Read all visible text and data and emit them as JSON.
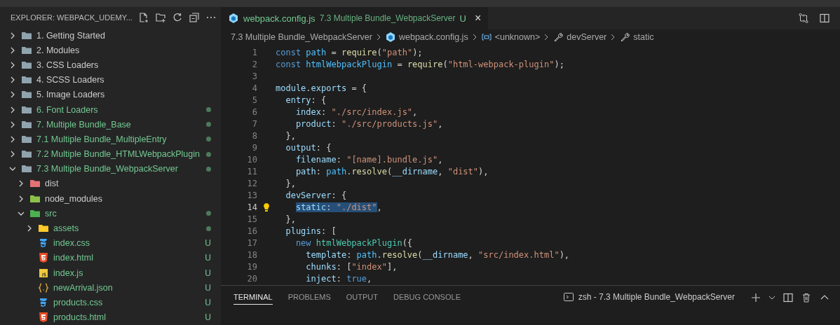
{
  "sidebar": {
    "title": "EXPLORER: WEBPACK_UDEMY...",
    "tree": [
      {
        "name": "1. Getting Started",
        "kind": "folder",
        "expanded": false,
        "modified": false
      },
      {
        "name": "2. Modules",
        "kind": "folder",
        "expanded": false,
        "modified": false
      },
      {
        "name": "3. CSS Loaders",
        "kind": "folder",
        "expanded": false,
        "modified": false
      },
      {
        "name": "4. SCSS Loaders",
        "kind": "folder",
        "expanded": false,
        "modified": false
      },
      {
        "name": "5. Image Loaders",
        "kind": "folder",
        "expanded": false,
        "modified": false
      },
      {
        "name": "6. Font Loaders",
        "kind": "folder",
        "expanded": false,
        "modified": true
      },
      {
        "name": "7. Multiple Bundle_Base",
        "kind": "folder",
        "expanded": false,
        "modified": true
      },
      {
        "name": "7.1 Multiple Bundle_MultipleEntry",
        "kind": "folder",
        "expanded": false,
        "modified": true
      },
      {
        "name": "7.2 Multiple Bundle_HTMLWebpackPlugin",
        "kind": "folder",
        "expanded": false,
        "modified": true
      },
      {
        "name": "7.3 Multiple Bundle_WebpackServer",
        "kind": "folder",
        "expanded": true,
        "modified": true,
        "children": [
          {
            "name": "dist",
            "kind": "folder-dist",
            "expanded": false,
            "modified": false
          },
          {
            "name": "node_modules",
            "kind": "folder-node",
            "expanded": false,
            "modified": false
          },
          {
            "name": "src",
            "kind": "folder-src",
            "expanded": true,
            "modified": true,
            "children": [
              {
                "name": "assets",
                "kind": "folder-assets",
                "expanded": false,
                "modified": true
              },
              {
                "name": "index.css",
                "kind": "css",
                "badge": "U"
              },
              {
                "name": "index.html",
                "kind": "html",
                "badge": "U"
              },
              {
                "name": "index.js",
                "kind": "js",
                "badge": "U"
              },
              {
                "name": "newArrival.json",
                "kind": "json",
                "badge": "U"
              },
              {
                "name": "products.css",
                "kind": "css",
                "badge": "U"
              },
              {
                "name": "products.html",
                "kind": "html",
                "badge": "U"
              }
            ]
          }
        ]
      }
    ]
  },
  "editor": {
    "tabs": [
      {
        "name": "webpack.config.js",
        "description": "7.3 Multiple Bundle_WebpackServer",
        "badge": "U",
        "close": "×",
        "selected": true
      }
    ],
    "breadcrumbs": [
      {
        "text": "7.3 Multiple Bundle_WebpackServer",
        "kind": "folder"
      },
      {
        "text": "webpack.config.js",
        "kind": "webpack"
      },
      {
        "text": "<unknown>",
        "kind": "variable"
      },
      {
        "text": "devServer",
        "kind": "property"
      },
      {
        "text": "static",
        "kind": "property"
      }
    ],
    "lines": [
      {
        "num": "1",
        "current": false,
        "lightbulb": false,
        "tokens": [
          {
            "text": "const ",
            "kind": "kw"
          },
          {
            "text": "path",
            "kind": "const"
          },
          {
            "text": " = ",
            "kind": "p"
          },
          {
            "text": "require",
            "kind": "fn"
          },
          {
            "text": "(",
            "kind": "p"
          },
          {
            "text": "\"path\"",
            "kind": "str"
          },
          {
            "text": ");",
            "kind": "p"
          }
        ]
      },
      {
        "num": "2",
        "current": false,
        "lightbulb": false,
        "tokens": [
          {
            "text": "const ",
            "kind": "kw"
          },
          {
            "text": "htmlWebpackPlugin",
            "kind": "const"
          },
          {
            "text": " = ",
            "kind": "p"
          },
          {
            "text": "require",
            "kind": "fn"
          },
          {
            "text": "(",
            "kind": "p"
          },
          {
            "text": "\"html-webpack-plugin\"",
            "kind": "str"
          },
          {
            "text": ");",
            "kind": "p"
          }
        ]
      },
      {
        "num": "3",
        "current": false,
        "lightbulb": false
      },
      {
        "num": "4",
        "current": false,
        "lightbulb": false,
        "tokens": [
          {
            "text": "module",
            "kind": "var"
          },
          {
            "text": ".",
            "kind": "p"
          },
          {
            "text": "exports",
            "kind": "var"
          },
          {
            "text": " = {",
            "kind": "p"
          }
        ]
      },
      {
        "num": "5",
        "current": false,
        "lightbulb": false,
        "tokens": [
          {
            "text": "  entry",
            "kind": "var"
          },
          {
            "text": ": {",
            "kind": "p"
          }
        ]
      },
      {
        "num": "6",
        "current": false,
        "lightbulb": false,
        "tokens": [
          {
            "text": "    index",
            "kind": "var"
          },
          {
            "text": ": ",
            "kind": "p"
          },
          {
            "text": "\"./src/index.js\"",
            "kind": "str"
          },
          {
            "text": ",",
            "kind": "p"
          }
        ]
      },
      {
        "num": "7",
        "current": false,
        "lightbulb": false,
        "tokens": [
          {
            "text": "    product",
            "kind": "var"
          },
          {
            "text": ": ",
            "kind": "p"
          },
          {
            "text": "\"./src/products.js\"",
            "kind": "str"
          },
          {
            "text": ",",
            "kind": "p"
          }
        ]
      },
      {
        "num": "8",
        "current": false,
        "lightbulb": false,
        "tokens": [
          {
            "text": "  },",
            "kind": "p"
          }
        ]
      },
      {
        "num": "9",
        "current": false,
        "lightbulb": false,
        "tokens": [
          {
            "text": "  output",
            "kind": "var"
          },
          {
            "text": ": {",
            "kind": "p"
          }
        ]
      },
      {
        "num": "10",
        "current": false,
        "lightbulb": false,
        "tokens": [
          {
            "text": "    filename",
            "kind": "var"
          },
          {
            "text": ": ",
            "kind": "p"
          },
          {
            "text": "\"[name].bundle.js\"",
            "kind": "str"
          },
          {
            "text": ",",
            "kind": "p"
          }
        ]
      },
      {
        "num": "11",
        "current": false,
        "lightbulb": false,
        "tokens": [
          {
            "text": "    path",
            "kind": "var"
          },
          {
            "text": ": ",
            "kind": "p"
          },
          {
            "text": "path",
            "kind": "const"
          },
          {
            "text": ".",
            "kind": "p"
          },
          {
            "text": "resolve",
            "kind": "fn"
          },
          {
            "text": "(",
            "kind": "p"
          },
          {
            "text": "__dirname",
            "kind": "var"
          },
          {
            "text": ", ",
            "kind": "p"
          },
          {
            "text": "\"dist\"",
            "kind": "str"
          },
          {
            "text": "),",
            "kind": "p"
          }
        ]
      },
      {
        "num": "12",
        "current": false,
        "lightbulb": false,
        "tokens": [
          {
            "text": "  },",
            "kind": "p"
          }
        ]
      },
      {
        "num": "13",
        "current": false,
        "lightbulb": false,
        "tokens": [
          {
            "text": "  devServer",
            "kind": "var"
          },
          {
            "text": ": {",
            "kind": "p"
          }
        ]
      },
      {
        "num": "14",
        "current": true,
        "lightbulb": true,
        "tokens": [
          {
            "text": "    static",
            "kind": "var",
            "selected": true
          },
          {
            "text": ": ",
            "kind": "p",
            "selected": true
          },
          {
            "text": "\"./dist\"",
            "kind": "str",
            "selected": true
          },
          {
            "text": ",",
            "kind": "p",
            "selected": false
          }
        ]
      },
      {
        "num": "15",
        "current": false,
        "lightbulb": false,
        "tokens": [
          {
            "text": "  },",
            "kind": "p"
          }
        ]
      },
      {
        "num": "16",
        "current": false,
        "lightbulb": false,
        "tokens": [
          {
            "text": "  plugins",
            "kind": "var"
          },
          {
            "text": ": [",
            "kind": "p"
          }
        ]
      },
      {
        "num": "17",
        "current": false,
        "lightbulb": false,
        "tokens": [
          {
            "text": "    new ",
            "kind": "kw"
          },
          {
            "text": "htmlWebpackPlugin",
            "kind": "cls"
          },
          {
            "text": "({",
            "kind": "p"
          }
        ]
      },
      {
        "num": "18",
        "current": false,
        "lightbulb": false,
        "tokens": [
          {
            "text": "      template",
            "kind": "var"
          },
          {
            "text": ": ",
            "kind": "p"
          },
          {
            "text": "path",
            "kind": "const"
          },
          {
            "text": ".",
            "kind": "p"
          },
          {
            "text": "resolve",
            "kind": "fn"
          },
          {
            "text": "(",
            "kind": "p"
          },
          {
            "text": "__dirname",
            "kind": "var"
          },
          {
            "text": ", ",
            "kind": "p"
          },
          {
            "text": "\"src/index.html\"",
            "kind": "str"
          },
          {
            "text": "),",
            "kind": "p"
          }
        ]
      },
      {
        "num": "19",
        "current": false,
        "lightbulb": false,
        "tokens": [
          {
            "text": "      chunks",
            "kind": "var"
          },
          {
            "text": ": [",
            "kind": "p"
          },
          {
            "text": "\"index\"",
            "kind": "str"
          },
          {
            "text": "],",
            "kind": "p"
          }
        ]
      },
      {
        "num": "20",
        "current": false,
        "lightbulb": false,
        "tokens": [
          {
            "text": "      inject",
            "kind": "var"
          },
          {
            "text": ": ",
            "kind": "p"
          },
          {
            "text": "true",
            "kind": "kw"
          },
          {
            "text": ",",
            "kind": "p"
          }
        ]
      }
    ]
  },
  "panel": {
    "tabs": [
      {
        "label": "TERMINAL",
        "selected": true
      },
      {
        "label": "PROBLEMS",
        "selected": false
      },
      {
        "label": "OUTPUT",
        "selected": false
      },
      {
        "label": "DEBUG CONSOLE",
        "selected": false
      }
    ],
    "terminal": "zsh - 7.3 Multiple Bundle_WebpackServer"
  }
}
